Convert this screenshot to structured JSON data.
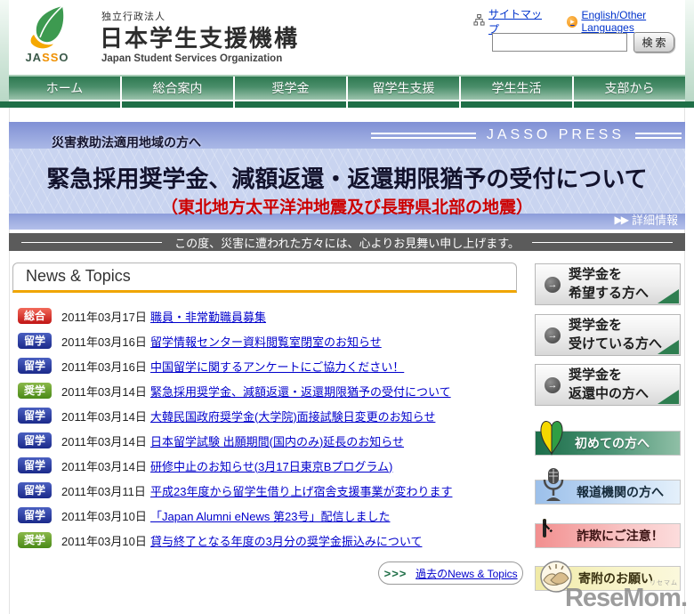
{
  "header": {
    "logo": {
      "part1": "JA",
      "part2": "SS",
      "part3": "O"
    },
    "org_type": "独立行政法人",
    "org_name": "日本学生支援機構",
    "org_name_en": "Japan Student Services Organization",
    "sitemap_label": "サイトマップ",
    "english_label": "English/Other Languages",
    "search_value": "",
    "search_button": "検索"
  },
  "nav": {
    "items": [
      {
        "label": "ホーム"
      },
      {
        "label": "総合案内"
      },
      {
        "label": "奨学金"
      },
      {
        "label": "留学生支援"
      },
      {
        "label": "学生生活"
      },
      {
        "label": "支部から"
      }
    ]
  },
  "press": {
    "press_label": "JASSO PRESS",
    "lead": "災害救助法適用地域の方へ",
    "title": "緊急採用奨学金、減額返還・返還期限猶予の受付について",
    "subtitle": "（東北地方太平洋沖地震及び長野県北部の地震）",
    "detail_arrows": "▶▶",
    "detail_link": "詳細情報",
    "condolence": "この度、災害に遭われた方々には、心よりお見舞い申し上げます。"
  },
  "news": {
    "title": "News & Topics",
    "archive_chevrons": ">>>",
    "archive_link": "過去のNews & Topics",
    "items": [
      {
        "badge": "総合",
        "badge_class": "badge-red",
        "date": "2011年03月17日",
        "text": "職員・非常勤職員募集"
      },
      {
        "badge": "留学",
        "badge_class": "badge-blue",
        "date": "2011年03月16日",
        "text": "留学情報センター資料閲覧室閉室のお知らせ"
      },
      {
        "badge": "留学",
        "badge_class": "badge-blue",
        "date": "2011年03月16日",
        "text": "中国留学に関するアンケートにご協力ください！"
      },
      {
        "badge": "奨学",
        "badge_class": "badge-green",
        "date": "2011年03月14日",
        "text": "緊急採用奨学金、減額返還・返還期限猶予の受付について"
      },
      {
        "badge": "留学",
        "badge_class": "badge-blue",
        "date": "2011年03月14日",
        "text": "大韓民国政府奨学金(大学院)面接試験日変更のお知らせ"
      },
      {
        "badge": "留学",
        "badge_class": "badge-blue",
        "date": "2011年03月14日",
        "text": "日本留学試験 出願期間(国内のみ)延長のお知らせ"
      },
      {
        "badge": "留学",
        "badge_class": "badge-blue",
        "date": "2011年03月14日",
        "text": "研修中止のお知らせ(3月17日東京Bプログラム)"
      },
      {
        "badge": "留学",
        "badge_class": "badge-blue",
        "date": "2011年03月11日",
        "text": "平成23年度から留学生借り上げ宿舎支援事業が変わります"
      },
      {
        "badge": "留学",
        "badge_class": "badge-blue",
        "date": "2011年03月10日",
        "text": "「Japan Alumni eNews 第23号」配信しました"
      },
      {
        "badge": "奨学",
        "badge_class": "badge-green",
        "date": "2011年03月10日",
        "text": "貸与終了となる年度の3月分の奨学金振込みについて"
      }
    ]
  },
  "sidebar": {
    "buttons": [
      {
        "line1": "奨学金を",
        "line2": "希望する方へ"
      },
      {
        "line1": "奨学金を",
        "line2": "受けている方へ"
      },
      {
        "line1": "奨学金を",
        "line2": "返還中の方へ"
      }
    ],
    "banners": [
      {
        "label": "初めての方へ"
      },
      {
        "label": "報道機関の方へ"
      },
      {
        "label": "詐欺にご注意！"
      },
      {
        "label": "寄附のお願い"
      }
    ]
  },
  "watermark": {
    "ruby": "リセマム",
    "text": "ReseMom."
  },
  "colors": {
    "nav_green": "#2e7951",
    "nav_under_green": "#1f6f47",
    "banner_blue": "#c9d4f0",
    "alert_red": "#cc0000",
    "accent_orange": "#f0a500",
    "badge_red": "#c01515",
    "badge_blue": "#1b2a8a",
    "badge_green": "#4a8a18",
    "condolence_gray": "#5b5b5b"
  }
}
